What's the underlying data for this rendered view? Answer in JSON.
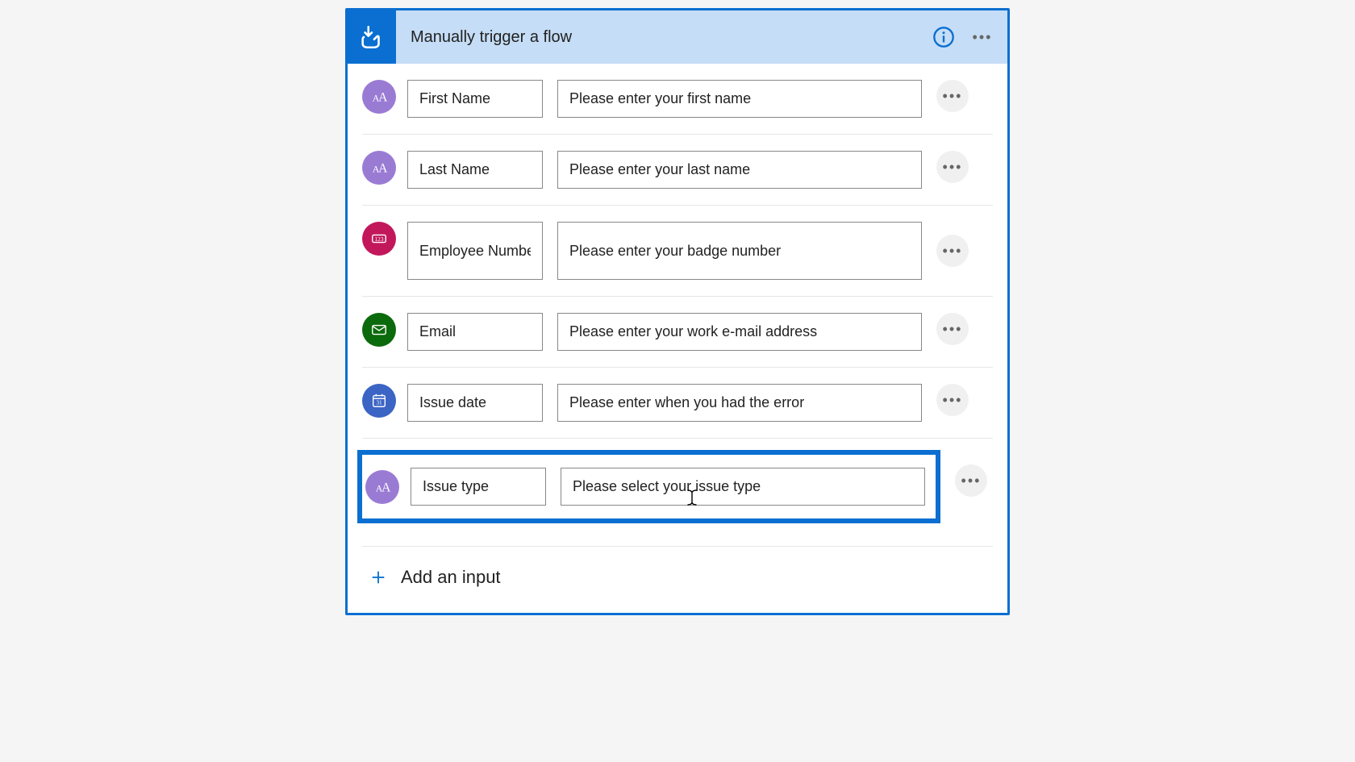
{
  "header": {
    "title": "Manually trigger a flow"
  },
  "rows": [
    {
      "name": "First Name",
      "desc": "Please enter your first name"
    },
    {
      "name": "Last Name",
      "desc": "Please enter your last name"
    },
    {
      "name": "Employee Number",
      "desc": "Please enter your badge number"
    },
    {
      "name": "Email",
      "desc": "Please enter your work e-mail address"
    },
    {
      "name": "Issue date",
      "desc": "Please enter when you had the error"
    },
    {
      "name": "Issue type",
      "desc": "Please select your issue type"
    }
  ],
  "addInput": "Add an input"
}
